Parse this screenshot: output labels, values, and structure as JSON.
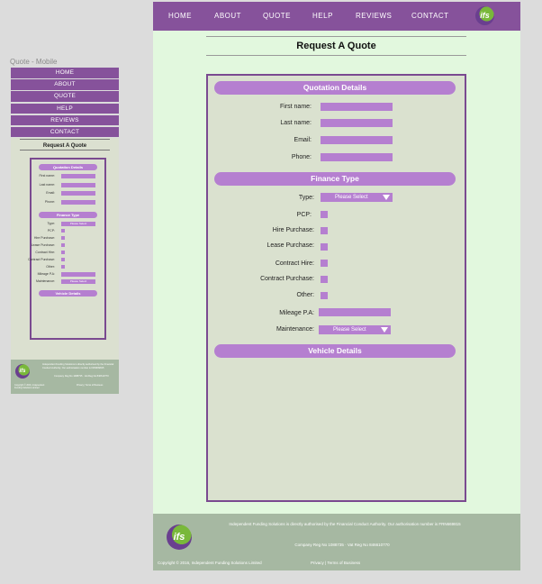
{
  "mobile": {
    "caption": "Quote - Mobile",
    "nav": [
      "HOME",
      "ABOUT",
      "QUOTE",
      "HELP",
      "REVIEWS",
      "CONTACT"
    ],
    "heading": "Request A Quote",
    "sections": {
      "quotation": "Quotation Details",
      "finance": "Finance Type",
      "vehicle": "Vehicle Details"
    },
    "fields": [
      "First name:",
      "Last name:",
      "Email:",
      "Phone:"
    ],
    "finance_fields": [
      "Type:",
      "PCP:",
      "Hire Purchase:",
      "Lease Purchase:",
      "Contract Hire:",
      "Contract Purchase:",
      "Other:",
      "Mileage P.A:",
      "Maintenance:"
    ],
    "select_placeholder": "Please Select",
    "footer": {
      "logo": "ifs",
      "authority": "Independent Funding Solutions is directly authorised by the Financial Conduct Authority. Our authorisation number is FRN669815",
      "reg": "Company Reg No 1088735 · Vat Reg No 846610770",
      "copyright": "Copyright © 2016, Independent Funding Solutions Limited",
      "links": "Privacy | Terms of Business"
    }
  },
  "desktop": {
    "nav": [
      "HOME",
      "ABOUT",
      "QUOTE",
      "HELP",
      "REVIEWS",
      "CONTACT"
    ],
    "logo": "ifs",
    "heading": "Request A Quote",
    "sections": {
      "quotation": "Quotation Details",
      "finance": "Finance Type",
      "vehicle": "Vehicle Details"
    },
    "labels": {
      "first_name": "First name:",
      "last_name": "Last name:",
      "email": "Email:",
      "phone": "Phone:",
      "type": "Type:",
      "pcp": "PCP:",
      "hire_purchase": "Hire Purchase:",
      "lease_purchase": "Lease Purchase:",
      "contract_hire": "Contract Hire:",
      "contract_purchase": "Contract Purchase:",
      "other": "Other:",
      "mileage": "Mileage P.A:",
      "maintenance": "Maintenance:"
    },
    "select_placeholder": "Please Select",
    "footer": {
      "authority": "Independent Funding Solutions is directly authorised by the Financial Conduct Authority. Our authorisation number is FRN669815",
      "reg": "Company Reg No 1088735 · Vat Reg No 846610770",
      "copyright": "Copyright © 2016, Independent Funding Solutions Limited",
      "links": "Privacy | Terms of Business"
    }
  },
  "colors": {
    "purple": "#86529b",
    "lilac": "#b57fd0",
    "green_bg": "#e2f8de",
    "footer": "#a6b8a2"
  }
}
